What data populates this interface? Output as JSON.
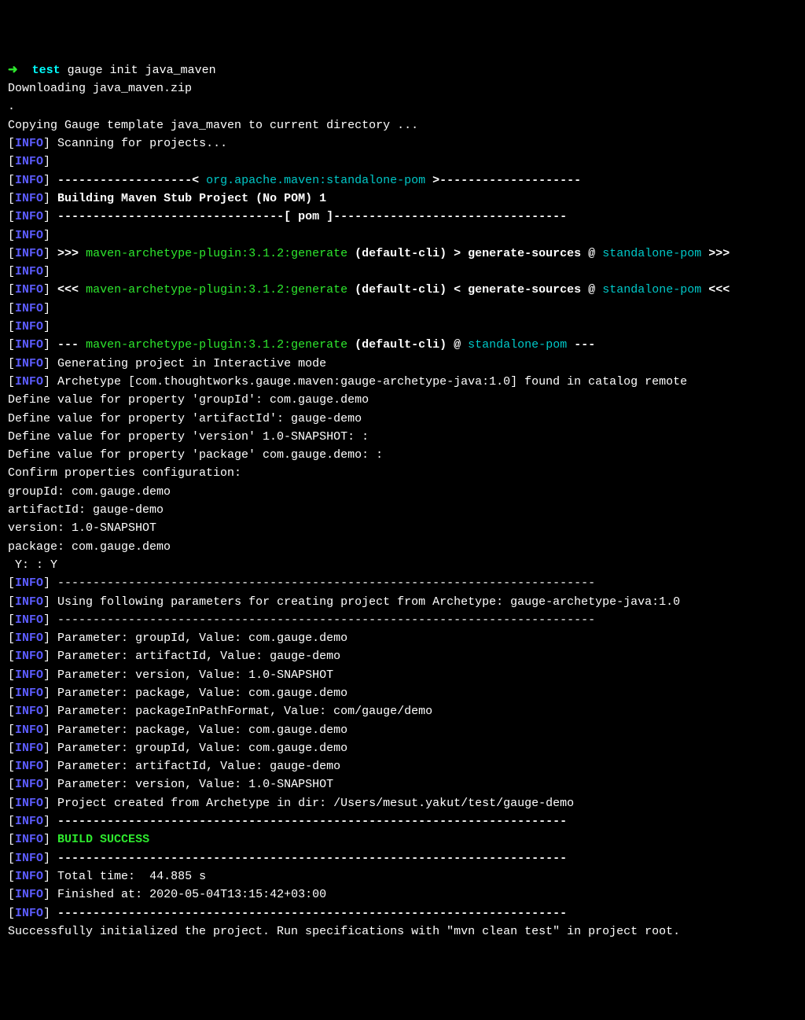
{
  "prompt": {
    "arrow": "➜",
    "label": "test",
    "command": "gauge init java_maven"
  },
  "lines": {
    "downloading": "Downloading java_maven.zip",
    "dot": ".",
    "copying": "Copying Gauge template java_maven to current directory ...",
    "scanning": "Scanning for projects...",
    "rule_prefix": "-------------------< ",
    "pom_id": "org.apache.maven:standalone-pom",
    "rule_suffix": " >--------------------",
    "building": "Building Maven Stub Project (No POM) 1",
    "pom_divider": "--------------------------------[ pom ]---------------------------------",
    "arrows_out": ">>> ",
    "arrows_in": "<<< ",
    "plugin_generate": "maven-archetype-plugin:3.1.2:generate",
    "default_cli": " (default-cli)",
    "gt_generate": " > generate-sources @ ",
    "lt_generate": " < generate-sources @ ",
    "at_only": " @ ",
    "standalone_pom": "standalone-pom",
    "trailing_out": " >>>",
    "trailing_in": " <<<",
    "dashes3": "--- ",
    "dashes3_end": " ---",
    "gen_interactive": "Generating project in Interactive mode",
    "archetype_found": "Archetype [com.thoughtworks.gauge.maven:gauge-archetype-java:1.0] found in catalog remote",
    "def_group": "Define value for property 'groupId': com.gauge.demo",
    "def_artifact": "Define value for property 'artifactId': gauge-demo",
    "def_version": "Define value for property 'version' 1.0-SNAPSHOT: :",
    "def_package": "Define value for property 'package' com.gauge.demo: :",
    "confirm": "Confirm properties configuration:",
    "c_group": "groupId: com.gauge.demo",
    "c_artifact": "artifactId: gauge-demo",
    "c_version": "version: 1.0-SNAPSHOT",
    "c_package": "package: com.gauge.demo",
    "yes": " Y: : Y",
    "long_rule": "----------------------------------------------------------------------------",
    "using_params": "Using following parameters for creating project from Archetype: gauge-archetype-java:1.0",
    "p_group": "Parameter: groupId, Value: com.gauge.demo",
    "p_artifact": "Parameter: artifactId, Value: gauge-demo",
    "p_version": "Parameter: version, Value: 1.0-SNAPSHOT",
    "p_package": "Parameter: package, Value: com.gauge.demo",
    "p_pkgpath": "Parameter: packageInPathFormat, Value: com/gauge/demo",
    "p_package2": "Parameter: package, Value: com.gauge.demo",
    "p_group2": "Parameter: groupId, Value: com.gauge.demo",
    "p_artifact2": "Parameter: artifactId, Value: gauge-demo",
    "p_version2": "Parameter: version, Value: 1.0-SNAPSHOT",
    "project_created": "Project created from Archetype in dir: /Users/mesut.yakut/test/gauge-demo",
    "rule72": "------------------------------------------------------------------------",
    "build_success": "BUILD SUCCESS",
    "total_time": "Total time:  44.885 s",
    "finished_at": "Finished at: 2020-05-04T13:15:42+03:00",
    "success_msg": "Successfully initialized the project. Run specifications with \"mvn clean test\" in project root."
  },
  "info": {
    "open": "[",
    "tag": "INFO",
    "close": "] "
  }
}
